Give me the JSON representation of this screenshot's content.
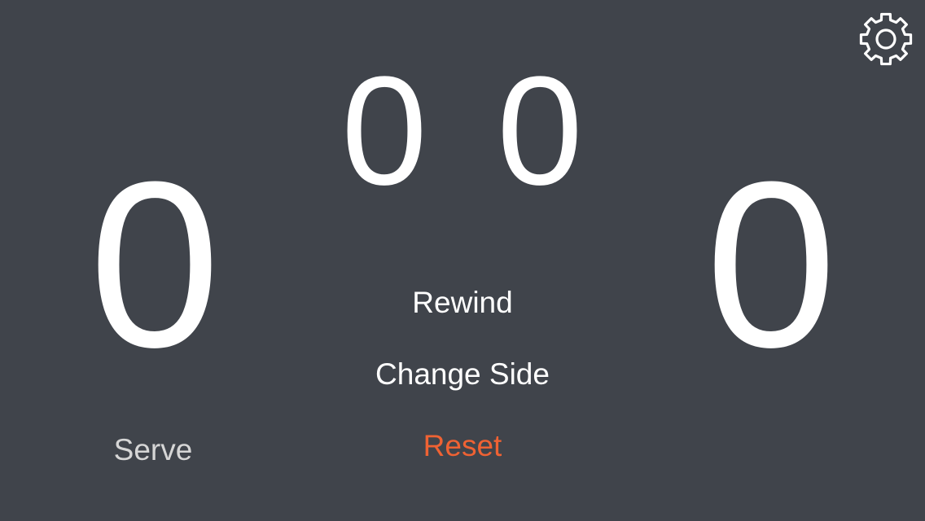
{
  "scores": {
    "left_points": "0",
    "right_points": "0",
    "left_sets": "0",
    "right_sets": "0"
  },
  "actions": {
    "rewind": "Rewind",
    "change_side": "Change Side",
    "reset": "Reset"
  },
  "serve_label": "Serve",
  "icons": {
    "settings": "gear-icon"
  },
  "colors": {
    "background": "#40444b",
    "text": "#ffffff",
    "reset_accent": "#ef6233",
    "serve_muted": "#d6d6d6"
  }
}
